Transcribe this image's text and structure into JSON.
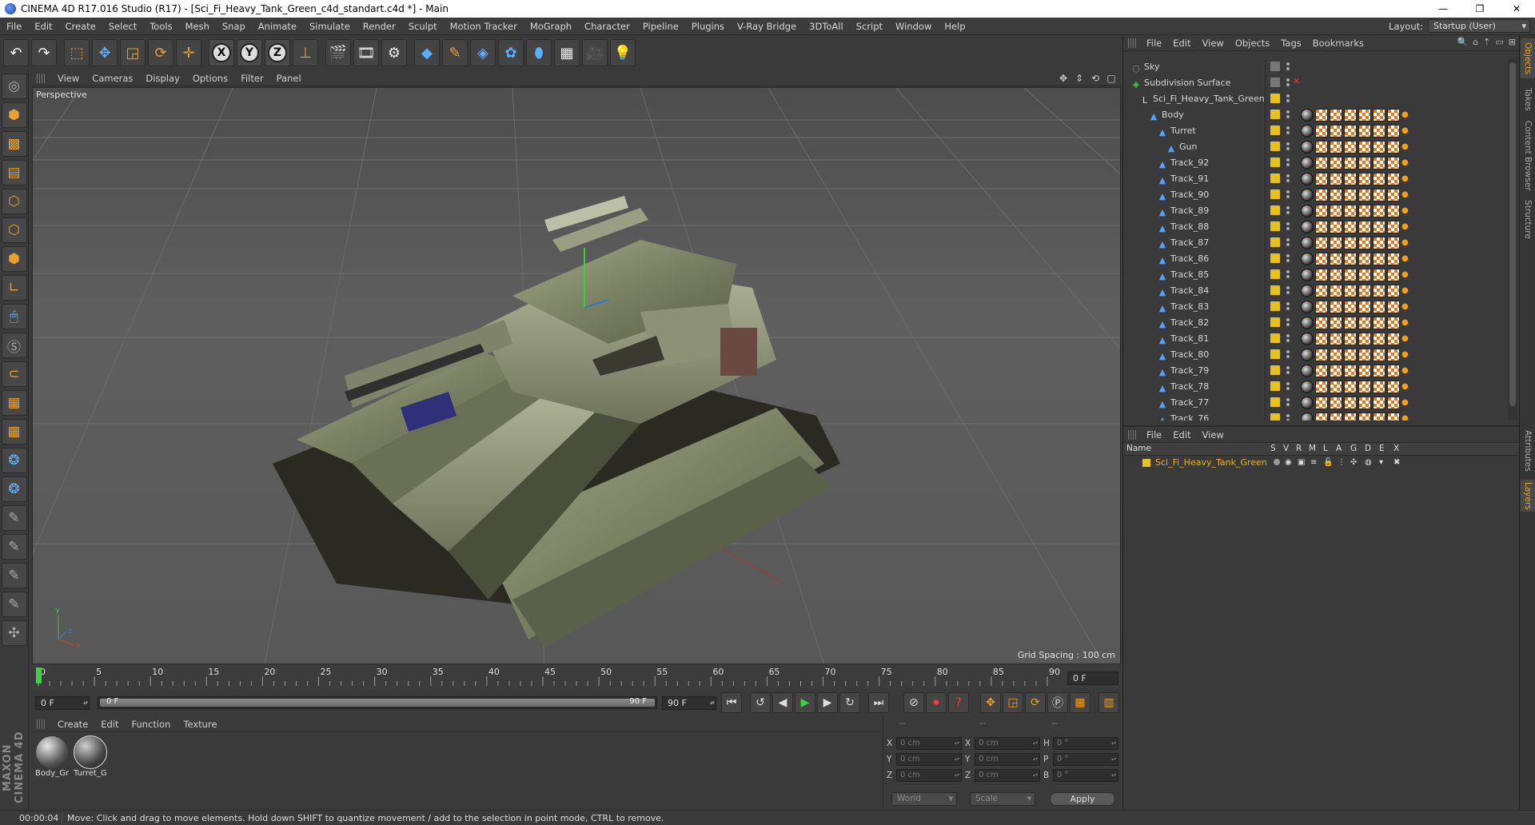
{
  "window": {
    "title": "CINEMA 4D R17.016 Studio (R17) - [Sci_Fi_Heavy_Tank_Green_c4d_standart.c4d *] - Main",
    "controls": [
      "—",
      "❐",
      "✕"
    ]
  },
  "menu": [
    "File",
    "Edit",
    "Create",
    "Select",
    "Tools",
    "Mesh",
    "Snap",
    "Animate",
    "Simulate",
    "Render",
    "Sculpt",
    "Motion Tracker",
    "MoGraph",
    "Character",
    "Pipeline",
    "Plugins",
    "V-Ray Bridge",
    "3DToAll",
    "Script",
    "Window",
    "Help"
  ],
  "layout": {
    "label": "Layout:",
    "value": "Startup (User)"
  },
  "toolbar": {
    "axis_x": "X",
    "axis_y": "Y",
    "axis_z": "Z"
  },
  "viewport": {
    "menu": [
      "View",
      "Cameras",
      "Display",
      "Options",
      "Filter",
      "Panel"
    ],
    "label": "Perspective",
    "grid_spacing": "Grid Spacing : 100 cm",
    "axis_labels": {
      "y": "y",
      "x": "x",
      "z": "z"
    }
  },
  "timeline": {
    "ticks": [
      0,
      5,
      10,
      15,
      20,
      25,
      30,
      35,
      40,
      45,
      50,
      55,
      60,
      65,
      70,
      75,
      80,
      85,
      90
    ],
    "current_frame_field": "0 F",
    "start_field": "0 F",
    "range_start": "0 F",
    "range_end": "90 F",
    "end_field": "90 F"
  },
  "materials": {
    "menu": [
      "Create",
      "Edit",
      "Function",
      "Texture"
    ],
    "items": [
      {
        "label": "Body_Gr",
        "color": "#8a8a8a"
      },
      {
        "label": "Turret_G",
        "color": "#6a6a6a"
      }
    ]
  },
  "coords": {
    "header": [
      "--",
      "--",
      "--"
    ],
    "rows": [
      {
        "a1": "X",
        "v1": "0 cm",
        "a2": "X",
        "v2": "0 cm",
        "a3": "H",
        "v3": "0 °"
      },
      {
        "a1": "Y",
        "v1": "0 cm",
        "a2": "Y",
        "v2": "0 cm",
        "a3": "P",
        "v3": "0 °"
      },
      {
        "a1": "Z",
        "v1": "0 cm",
        "a2": "Z",
        "v2": "0 cm",
        "a3": "B",
        "v3": "0 °"
      }
    ],
    "space": "World",
    "mode": "Scale",
    "apply": "Apply"
  },
  "status": {
    "time": "00:00:04",
    "message": "Move: Click and drag to move elements. Hold down SHIFT to quantize movement / add to the selection in point mode, CTRL to remove."
  },
  "object_manager": {
    "menu": [
      "File",
      "Edit",
      "View",
      "Objects",
      "Tags",
      "Bookmarks"
    ],
    "objects": [
      {
        "name": "Sky",
        "indent": 0,
        "icon": "sky"
      },
      {
        "name": "Subdivision Surface",
        "indent": 0,
        "icon": "subdiv"
      },
      {
        "name": "Sci_Fi_Heavy_Tank_Green",
        "indent": 1,
        "icon": "null"
      },
      {
        "name": "Body",
        "indent": 2,
        "icon": "poly"
      },
      {
        "name": "Turret",
        "indent": 3,
        "icon": "poly"
      },
      {
        "name": "Gun",
        "indent": 4,
        "icon": "poly"
      },
      {
        "name": "Track_92",
        "indent": 3,
        "icon": "poly"
      },
      {
        "name": "Track_91",
        "indent": 3,
        "icon": "poly"
      },
      {
        "name": "Track_90",
        "indent": 3,
        "icon": "poly"
      },
      {
        "name": "Track_89",
        "indent": 3,
        "icon": "poly"
      },
      {
        "name": "Track_88",
        "indent": 3,
        "icon": "poly"
      },
      {
        "name": "Track_87",
        "indent": 3,
        "icon": "poly"
      },
      {
        "name": "Track_86",
        "indent": 3,
        "icon": "poly"
      },
      {
        "name": "Track_85",
        "indent": 3,
        "icon": "poly"
      },
      {
        "name": "Track_84",
        "indent": 3,
        "icon": "poly"
      },
      {
        "name": "Track_83",
        "indent": 3,
        "icon": "poly"
      },
      {
        "name": "Track_82",
        "indent": 3,
        "icon": "poly"
      },
      {
        "name": "Track_81",
        "indent": 3,
        "icon": "poly"
      },
      {
        "name": "Track_80",
        "indent": 3,
        "icon": "poly"
      },
      {
        "name": "Track_79",
        "indent": 3,
        "icon": "poly"
      },
      {
        "name": "Track_78",
        "indent": 3,
        "icon": "poly"
      },
      {
        "name": "Track_77",
        "indent": 3,
        "icon": "poly"
      },
      {
        "name": "Track_76",
        "indent": 3,
        "icon": "poly"
      }
    ]
  },
  "layer_manager": {
    "menu": [
      "File",
      "Edit",
      "View"
    ],
    "columns": [
      "Name",
      "S",
      "V",
      "R",
      "M",
      "L",
      "A",
      "G",
      "D",
      "E",
      "X"
    ],
    "layers": [
      {
        "name": "Sci_Fi_Heavy_Tank_Green",
        "color": "#e8c020"
      }
    ]
  },
  "side_tabs": [
    "Objects",
    "Takes",
    "Content Browser",
    "Structure",
    "Attributes",
    "Layers"
  ],
  "colors": {
    "accent": "#f0a020",
    "layer_yellow": "#e8c020",
    "play_green": "#3fd23f"
  }
}
